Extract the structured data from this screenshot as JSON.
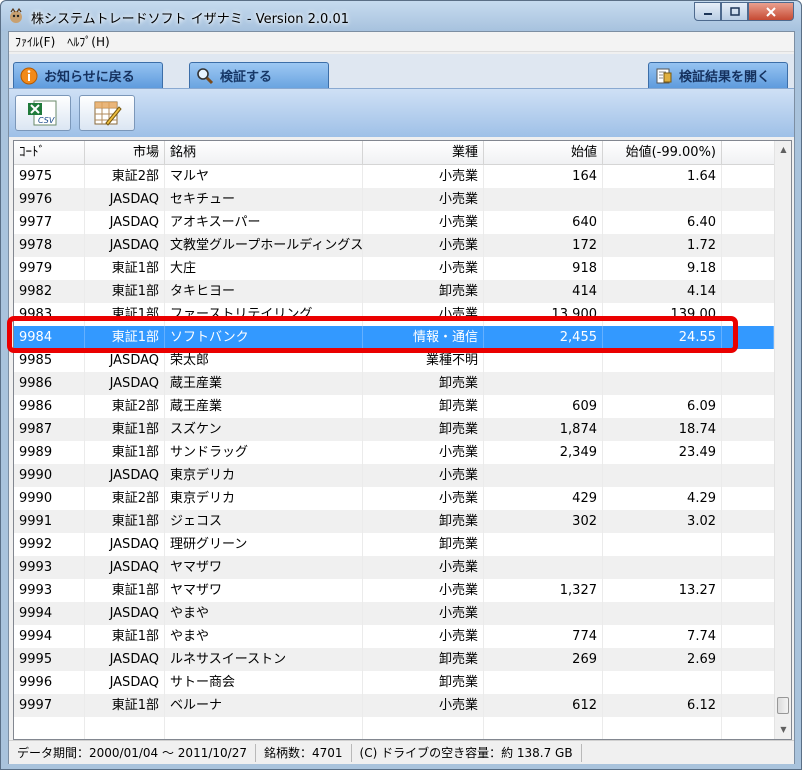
{
  "window": {
    "title": "株システムトレードソフト イザナミ - Version 2.0.01"
  },
  "menu": [
    {
      "label": "ﾌｧｲﾙ(F)"
    },
    {
      "label": "ﾍﾙﾌﾟ(H)"
    }
  ],
  "tabs": [
    {
      "label": "お知らせに戻る",
      "icon": "info-icon"
    },
    {
      "label": "検証する",
      "icon": "magnifier-icon"
    },
    {
      "label": "検証結果を開く",
      "icon": "stamp-icon"
    }
  ],
  "toolbar": {
    "csv_label": "CSV",
    "buttons": [
      {
        "icon": "excel-csv-icon"
      },
      {
        "icon": "table-edit-icon"
      }
    ]
  },
  "table": {
    "headers": [
      "ｺｰﾄﾞ",
      "市場",
      "銘柄",
      "業種",
      "始値",
      "始値(-99.00%)"
    ],
    "rows": [
      [
        "9975",
        "東証2部",
        "マルヤ",
        "小売業",
        "164",
        "1.64"
      ],
      [
        "9976",
        "JASDAQ",
        "セキチュー",
        "小売業",
        "",
        ""
      ],
      [
        "9977",
        "JASDAQ",
        "アオキスーパー",
        "小売業",
        "640",
        "6.40"
      ],
      [
        "9978",
        "JASDAQ",
        "文教堂グループホールディングス",
        "小売業",
        "172",
        "1.72"
      ],
      [
        "9979",
        "東証1部",
        "大庄",
        "小売業",
        "918",
        "9.18"
      ],
      [
        "9982",
        "東証1部",
        "タキヒヨー",
        "卸売業",
        "414",
        "4.14"
      ],
      [
        "9983",
        "東証1部",
        "ファーストリテイリング",
        "小売業",
        "13,900",
        "139.00"
      ],
      [
        "9984",
        "東証1部",
        "ソフトバンク",
        "情報・通信",
        "2,455",
        "24.55"
      ],
      [
        "9985",
        "JASDAQ",
        "荣太郎",
        "業種不明",
        "",
        ""
      ],
      [
        "9986",
        "JASDAQ",
        "蔵王産業",
        "卸売業",
        "",
        ""
      ],
      [
        "9986",
        "東証2部",
        "蔵王産業",
        "卸売業",
        "609",
        "6.09"
      ],
      [
        "9987",
        "東証1部",
        "スズケン",
        "卸売業",
        "1,874",
        "18.74"
      ],
      [
        "9989",
        "東証1部",
        "サンドラッグ",
        "小売業",
        "2,349",
        "23.49"
      ],
      [
        "9990",
        "JASDAQ",
        "東京デリカ",
        "小売業",
        "",
        ""
      ],
      [
        "9990",
        "東証2部",
        "東京デリカ",
        "小売業",
        "429",
        "4.29"
      ],
      [
        "9991",
        "東証1部",
        "ジェコス",
        "卸売業",
        "302",
        "3.02"
      ],
      [
        "9992",
        "JASDAQ",
        "理研グリーン",
        "卸売業",
        "",
        ""
      ],
      [
        "9993",
        "JASDAQ",
        "ヤマザワ",
        "小売業",
        "",
        ""
      ],
      [
        "9993",
        "東証1部",
        "ヤマザワ",
        "小売業",
        "1,327",
        "13.27"
      ],
      [
        "9994",
        "JASDAQ",
        "やまや",
        "小売業",
        "",
        ""
      ],
      [
        "9994",
        "東証1部",
        "やまや",
        "小売業",
        "774",
        "7.74"
      ],
      [
        "9995",
        "JASDAQ",
        "ルネサスイーストン",
        "卸売業",
        "269",
        "2.69"
      ],
      [
        "9996",
        "JASDAQ",
        "サトー商会",
        "卸売業",
        "",
        ""
      ],
      [
        "9997",
        "東証1部",
        "ベルーナ",
        "小売業",
        "612",
        "6.12"
      ],
      [
        "",
        "",
        "",
        "",
        "",
        ""
      ]
    ],
    "selected_index": 7
  },
  "status": {
    "period": "データ期間：2000/01/04 ～ 2011/10/27",
    "count": "銘柄数：4701",
    "drive": "(C) ドライブの空き容量：約 138.7 GB"
  },
  "colors": {
    "selection": "#3399ff",
    "highlight_border": "#ea0000",
    "tab_blue": "#5e9bdd"
  }
}
